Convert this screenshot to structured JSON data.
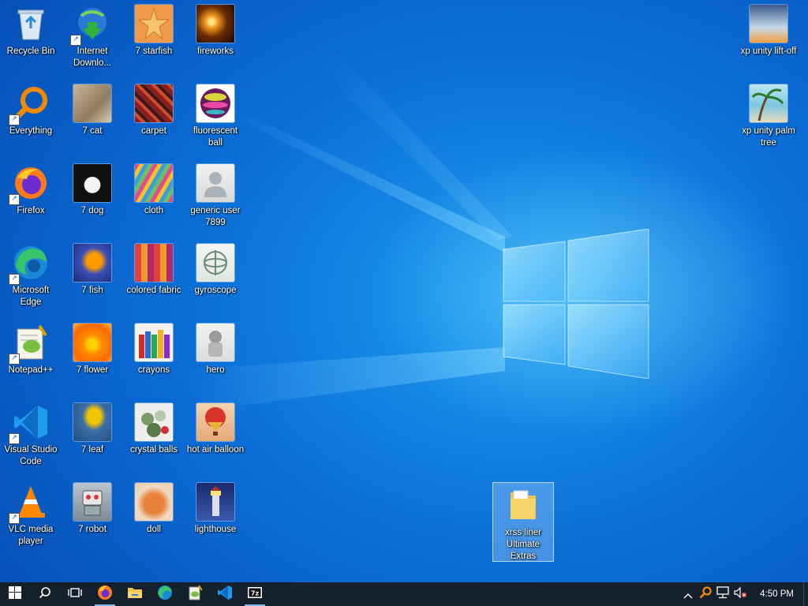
{
  "desktop": {
    "icons_col1": [
      {
        "label": "Recycle Bin",
        "icon": "recycle-bin-icon"
      },
      {
        "label": "Everything",
        "icon": "everything-search-icon"
      },
      {
        "label": "Firefox",
        "icon": "firefox-icon"
      },
      {
        "label": "Microsoft Edge",
        "icon": "edge-icon"
      },
      {
        "label": "Notepad++",
        "icon": "notepad-plus-plus-icon"
      },
      {
        "label": "Visual Studio Code",
        "icon": "vscode-icon"
      },
      {
        "label": "VLC media player",
        "icon": "vlc-icon"
      }
    ],
    "icons_col2": [
      {
        "label": "Internet Downlo...",
        "icon": "internet-download-manager-icon"
      },
      {
        "label": "7 cat",
        "icon": "cat-image-icon"
      },
      {
        "label": "7 dog",
        "icon": "dog-image-icon"
      },
      {
        "label": "7 fish",
        "icon": "fish-image-icon"
      },
      {
        "label": "7 flower",
        "icon": "flower-image-icon"
      },
      {
        "label": "7 leaf",
        "icon": "leaf-image-icon"
      },
      {
        "label": "7 robot",
        "icon": "robot-image-icon"
      }
    ],
    "icons_col3": [
      {
        "label": "7 starfish",
        "icon": "starfish-image-icon"
      },
      {
        "label": "carpet",
        "icon": "carpet-image-icon"
      },
      {
        "label": "cloth",
        "icon": "cloth-image-icon"
      },
      {
        "label": "colored fabric",
        "icon": "colored-fabric-image-icon"
      },
      {
        "label": "crayons",
        "icon": "crayons-image-icon"
      },
      {
        "label": "crystal balls",
        "icon": "crystal-balls-image-icon"
      },
      {
        "label": "doll",
        "icon": "doll-image-icon"
      }
    ],
    "icons_col4": [
      {
        "label": "fireworks",
        "icon": "fireworks-image-icon"
      },
      {
        "label": "fluorescent ball",
        "icon": "fluorescent-ball-image-icon"
      },
      {
        "label": "generic user 7899",
        "icon": "generic-user-image-icon"
      },
      {
        "label": "gyroscope",
        "icon": "gyroscope-image-icon"
      },
      {
        "label": "hero",
        "icon": "hero-image-icon"
      },
      {
        "label": "hot air balloon",
        "icon": "hot-air-balloon-image-icon"
      },
      {
        "label": "lighthouse",
        "icon": "lighthouse-image-icon"
      }
    ],
    "icons_right": [
      {
        "label": "xp unity lift-off",
        "icon": "lift-off-image-icon"
      },
      {
        "label": "xp unity palm tree",
        "icon": "palm-tree-image-icon"
      }
    ],
    "folder": {
      "label": "xrss liner Ultimate Extras",
      "icon": "folder-icon"
    }
  },
  "taskbar": {
    "items": [
      "start-icon",
      "search-icon",
      "task-view-icon",
      "firefox-icon",
      "file-explorer-icon",
      "edge-icon",
      "notepad-plus-plus-icon",
      "vscode-icon",
      "7zip-icon"
    ],
    "tray": [
      "chevron-up-icon",
      "everything-search-icon",
      "network-icon",
      "volume-muted-icon"
    ],
    "clock": "4:50 PM"
  }
}
